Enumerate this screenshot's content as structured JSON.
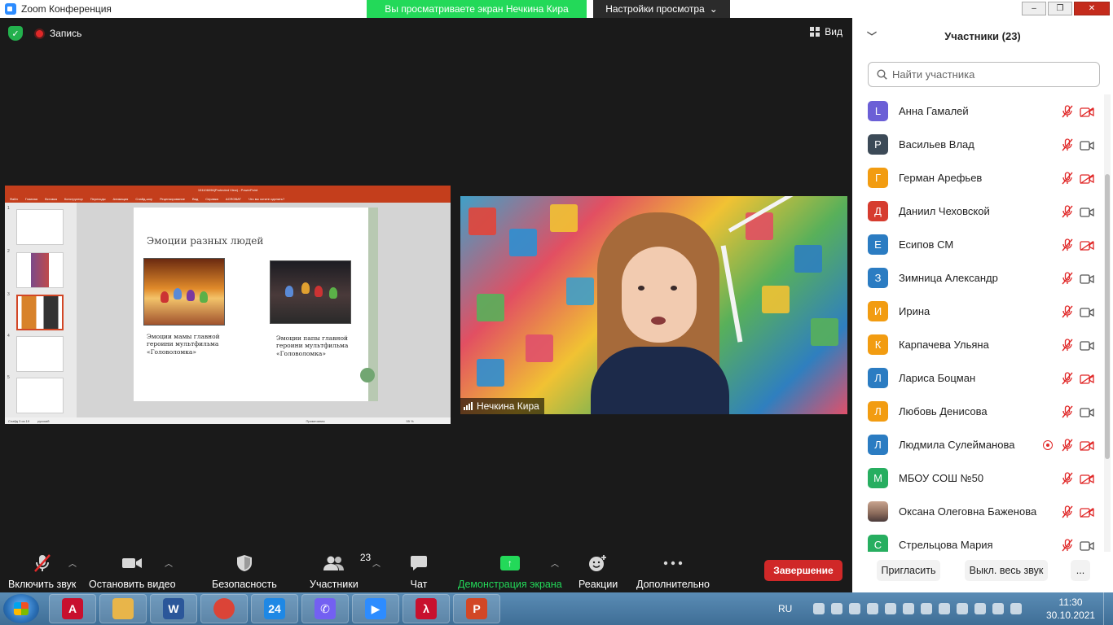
{
  "window": {
    "title": "Zoom Конференция",
    "share_banner": "Вы просматриваете экран Нечкина Кира",
    "view_settings": "Настройки просмотра",
    "controls": [
      "–",
      "❐",
      "✕"
    ]
  },
  "meeting": {
    "record_label": "Запись",
    "view_label": "Вид",
    "video_name": "Нечкина Кира",
    "shared": {
      "app_title": "151106096(Protected View) - PowerPoint",
      "ribbon": [
        "Файл",
        "Главная",
        "Вставка",
        "Конструктор",
        "Переходы",
        "Анимация",
        "Слайд-шоу",
        "Рецензирование",
        "Вид",
        "Справка",
        "ACROBAT",
        "Что вы хотите сделать?"
      ],
      "slide_heading": "Эмоции разных людей",
      "caption_left": "Эмоции мамы главной героини мультфильма «Головоломка»",
      "caption_right": "Эмоции папы главной героини мультфильма «Головоломка»",
      "thumb_numbers": [
        "1",
        "2",
        "3",
        "4",
        "5"
      ],
      "status_left": "Слайд 3 из 19",
      "status_lang": "русский",
      "status_notes": "Примечания",
      "status_zoom": "55 %"
    }
  },
  "toolbar": {
    "mute": "Включить звук",
    "video": "Остановить видео",
    "security": "Безопасность",
    "participants": "Участники",
    "participants_count": "23",
    "chat": "Чат",
    "share": "Демонстрация экрана",
    "reactions": "Реакции",
    "more": "Дополнительно",
    "end": "Завершение"
  },
  "panel": {
    "title": "Участники (23)",
    "search_placeholder": "Найти участника",
    "participants": [
      {
        "initial": "L",
        "name": "Анна Гамалей",
        "color": "#6b5fd6",
        "video_off": true,
        "recording": false
      },
      {
        "initial": "Р",
        "name": "Васильев Влад",
        "color": "#3c4a57",
        "video_off": false,
        "recording": false
      },
      {
        "initial": "Г",
        "name": "Герман Арефьев",
        "color": "#f29c11",
        "video_off": true,
        "recording": false
      },
      {
        "initial": "Д",
        "name": "Даниил Чеховской",
        "color": "#d63c2f",
        "video_off": false,
        "recording": false
      },
      {
        "initial": "Е",
        "name": "Есипов СМ",
        "color": "#2b7cc2",
        "video_off": true,
        "recording": false
      },
      {
        "initial": "З",
        "name": "Зимница Александр",
        "color": "#2b7cc2",
        "video_off": false,
        "recording": false
      },
      {
        "initial": "И",
        "name": "Ирина",
        "color": "#f29c11",
        "video_off": false,
        "recording": false
      },
      {
        "initial": "К",
        "name": "Карпачева Ульяна",
        "color": "#f29c11",
        "video_off": false,
        "recording": false
      },
      {
        "initial": "Л",
        "name": "Лариса Боцман",
        "color": "#2b7cc2",
        "video_off": true,
        "recording": false
      },
      {
        "initial": "Л",
        "name": "Любовь Денисова",
        "color": "#f29c11",
        "video_off": false,
        "recording": false
      },
      {
        "initial": "Л",
        "name": "Людмила Сулейманова",
        "color": "#2b7cc2",
        "video_off": true,
        "recording": true
      },
      {
        "initial": "М",
        "name": "МБОУ СОШ №50",
        "color": "#27ae60",
        "video_off": true,
        "recording": false
      },
      {
        "initial": "",
        "name": "Оксана Олеговна Баженова",
        "color": "#8a6a5a",
        "video_off": true,
        "recording": false
      },
      {
        "initial": "С",
        "name": "Стрельцова Мария",
        "color": "#27ae60",
        "video_off": false,
        "recording": false
      }
    ],
    "invite": "Пригласить",
    "mute_all": "Выкл. весь звук",
    "more": "..."
  },
  "taskbar": {
    "apps": [
      {
        "name": "adobe-reader-a",
        "glyph": "A",
        "color": "#c8102e"
      },
      {
        "name": "file-explorer",
        "glyph": "",
        "color": "#e8b54a"
      },
      {
        "name": "word",
        "glyph": "W",
        "color": "#2b579a"
      },
      {
        "name": "chrome",
        "glyph": "",
        "color": "#db4437"
      },
      {
        "name": "app-24",
        "glyph": "24",
        "color": "#1e88e5"
      },
      {
        "name": "viber",
        "glyph": "✆",
        "color": "#7360f2"
      },
      {
        "name": "zoom",
        "glyph": "▶",
        "color": "#2d8cff"
      },
      {
        "name": "acrobat",
        "glyph": "λ",
        "color": "#c8102e"
      },
      {
        "name": "powerpoint",
        "glyph": "P",
        "color": "#d24726"
      }
    ],
    "lang": "RU",
    "time": "11:30",
    "date": "30.10.2021"
  }
}
